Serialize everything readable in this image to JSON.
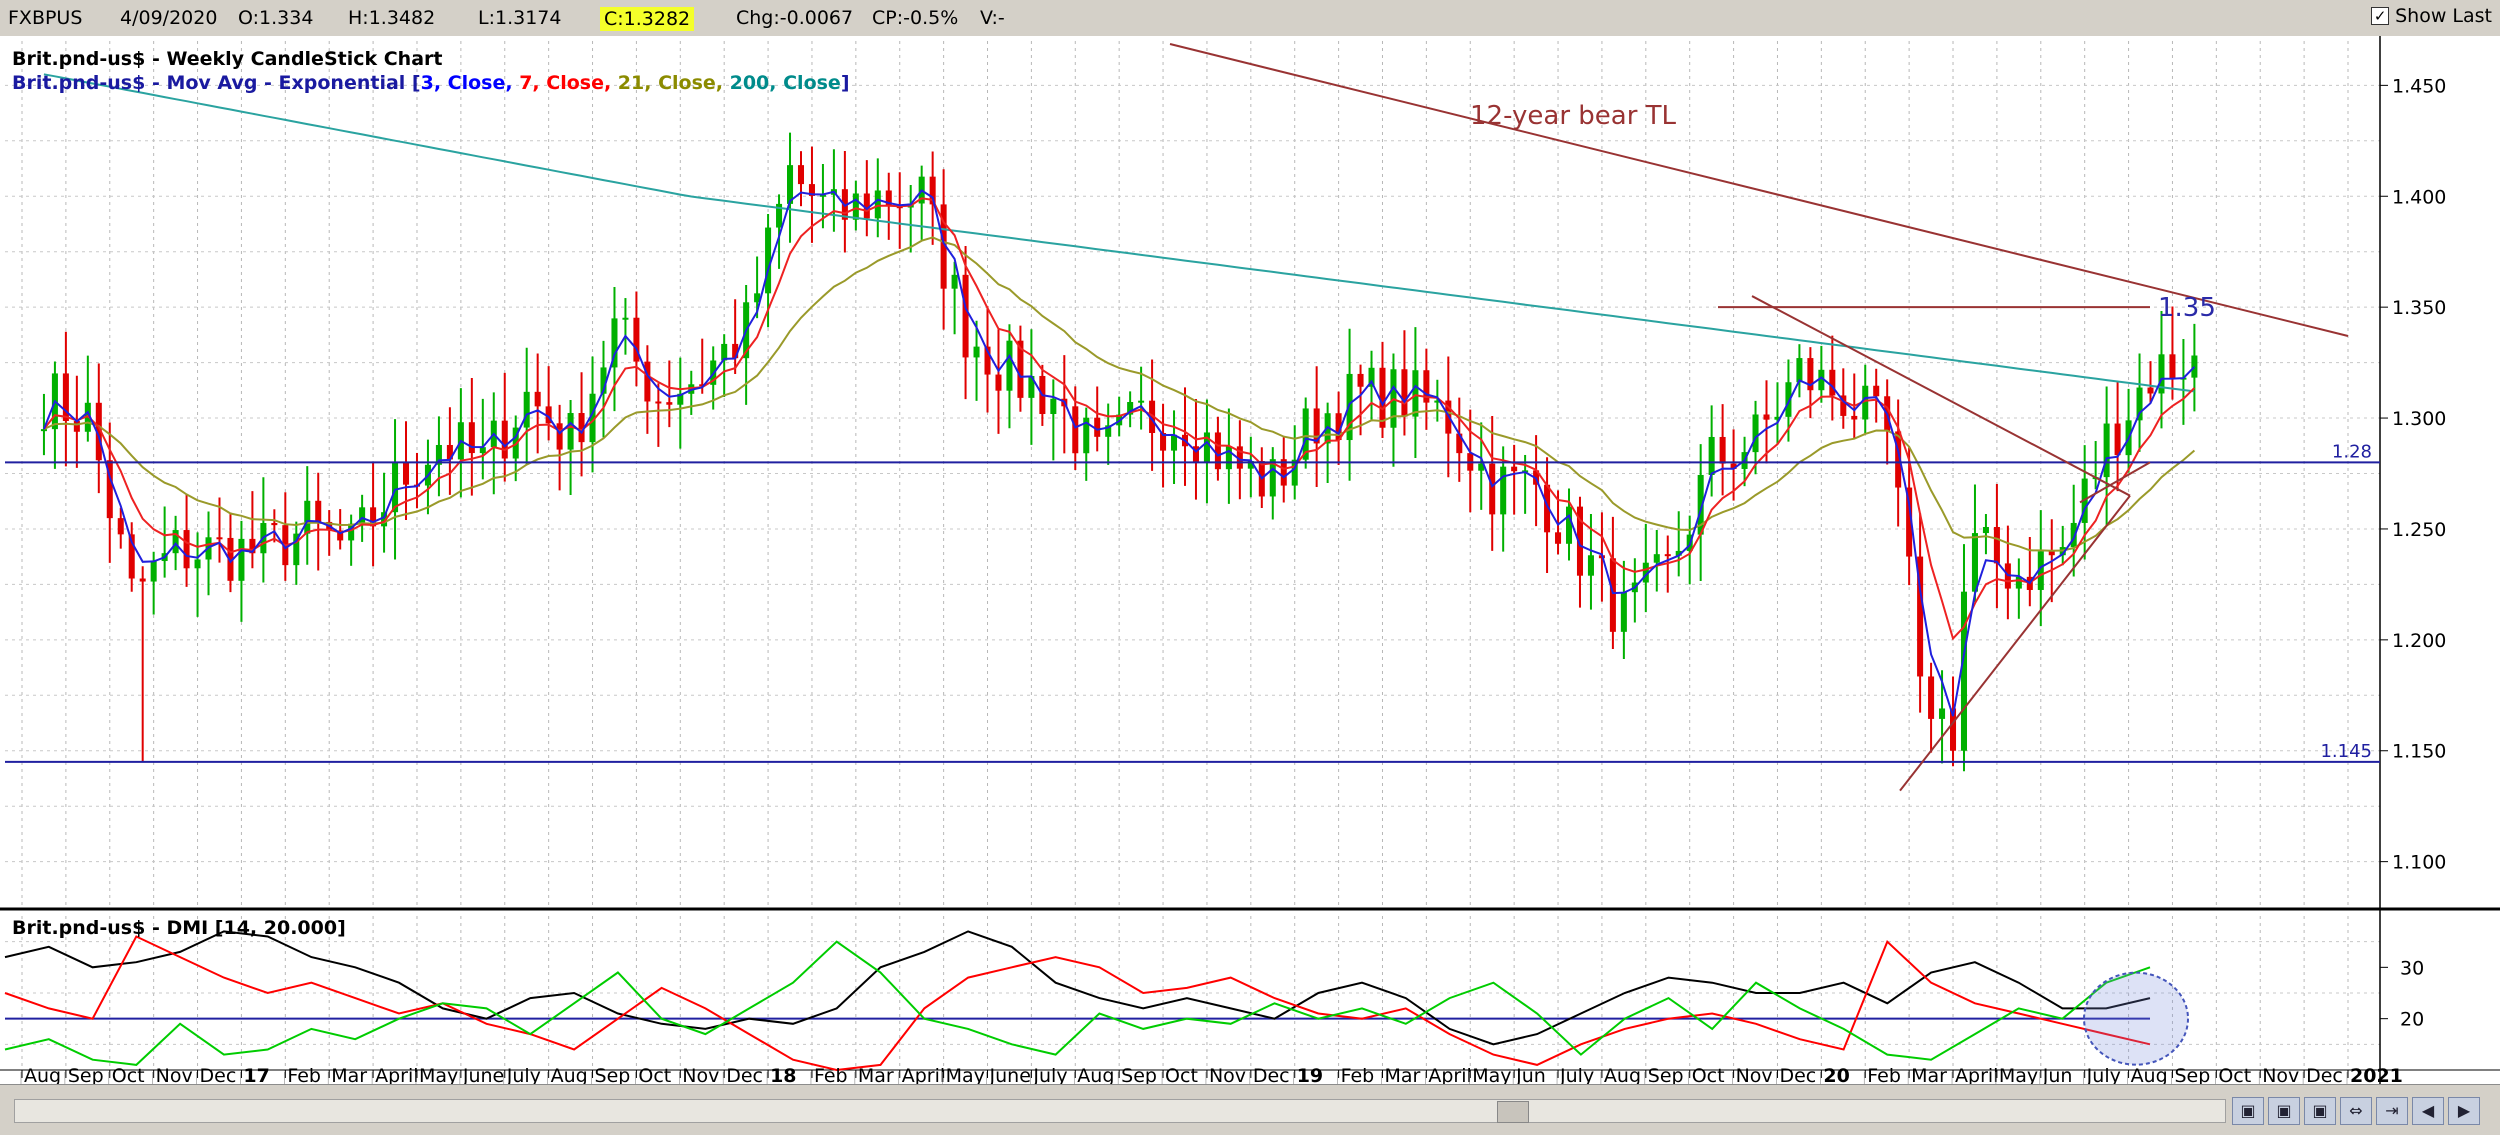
{
  "header": {
    "symbol": "FXBPUS",
    "date": "4/09/2020",
    "open": "O:1.334",
    "high": "H:1.3482",
    "low": "L:1.3174",
    "close": "C:1.3282",
    "change": "Chg:-0.0067",
    "change_pct": "CP:-0.5%",
    "volume": "V:-",
    "show_last_label": "Show Last",
    "show_last_checked": "✓"
  },
  "chart_data": [
    {
      "type": "candlestick",
      "title": "Brit.pnd-us$ - Weekly CandleStick Chart",
      "indicator_label": "Brit.pnd-us$ - Mov Avg - Exponential",
      "indicator_params": [
        {
          "text": "[",
          "color": "#1a1aa0"
        },
        {
          "text": "3, Close,",
          "color": "#0000ff"
        },
        {
          "text": " 7, Close,",
          "color": "#ff0000"
        },
        {
          "text": " 21, Close,",
          "color": "#8b8b00"
        },
        {
          "text": " 200, Close",
          "color": "#008b8b"
        },
        {
          "text": "]",
          "color": "#1a1aa0"
        }
      ],
      "ylim": [
        1.08,
        1.47
      ],
      "y_ticks": [
        "1.450",
        "1.400",
        "1.350",
        "1.300",
        "1.250",
        "1.200",
        "1.150",
        "1.100"
      ],
      "x_ticks": [
        "Aug",
        "Sep",
        "Oct",
        "Nov",
        "Dec",
        "17",
        "Feb",
        "Mar",
        "April",
        "May",
        "June",
        "July",
        "Aug",
        "Sep",
        "Oct",
        "Nov",
        "Dec",
        "18",
        "Feb",
        "Mar",
        "April",
        "May",
        "June",
        "July",
        "Aug",
        "Sep",
        "Oct",
        "Nov",
        "Dec",
        "19",
        "Feb",
        "Mar",
        "April",
        "May",
        "Jun",
        "July",
        "Aug",
        "Sep",
        "Oct",
        "Nov",
        "Dec",
        "20",
        "Feb",
        "Mar",
        "April",
        "May",
        "Jun",
        "July",
        "Aug",
        "Sep",
        "Oct",
        "Nov",
        "Dec",
        "2021"
      ],
      "bold_ticks": [
        "17",
        "18",
        "19",
        "20",
        "2021"
      ],
      "horizontal_levels": [
        {
          "value": 1.28,
          "label": "1.28",
          "color": "#2020a0"
        },
        {
          "value": 1.145,
          "label": "1.145",
          "color": "#2020a0"
        }
      ],
      "annotations": {
        "bear_trendline_label": "12-year bear TL",
        "resistance_label": "1.35"
      },
      "closes_key": [
        {
          "date": "2016-08",
          "close": 1.31
        },
        {
          "date": "2016-09",
          "close": 1.3
        },
        {
          "date": "2016-10",
          "close": 1.22
        },
        {
          "date": "2016-11",
          "close": 1.24
        },
        {
          "date": "2016-12",
          "close": 1.24
        },
        {
          "date": "2017-01",
          "close": 1.24
        },
        {
          "date": "2017-02",
          "close": 1.25
        },
        {
          "date": "2017-03",
          "close": 1.24
        },
        {
          "date": "2017-04",
          "close": 1.27
        },
        {
          "date": "2017-05",
          "close": 1.29
        },
        {
          "date": "2017-06",
          "close": 1.28
        },
        {
          "date": "2017-07",
          "close": 1.31
        },
        {
          "date": "2017-08",
          "close": 1.29
        },
        {
          "date": "2017-09",
          "close": 1.34
        },
        {
          "date": "2017-10",
          "close": 1.31
        },
        {
          "date": "2017-11",
          "close": 1.32
        },
        {
          "date": "2017-12",
          "close": 1.34
        },
        {
          "date": "2018-01",
          "close": 1.41
        },
        {
          "date": "2018-02",
          "close": 1.39
        },
        {
          "date": "2018-03",
          "close": 1.4
        },
        {
          "date": "2018-04",
          "close": 1.4
        },
        {
          "date": "2018-05",
          "close": 1.34
        },
        {
          "date": "2018-06",
          "close": 1.32
        },
        {
          "date": "2018-07",
          "close": 1.31
        },
        {
          "date": "2018-08",
          "close": 1.28
        },
        {
          "date": "2018-09",
          "close": 1.3
        },
        {
          "date": "2018-10",
          "close": 1.3
        },
        {
          "date": "2018-11",
          "close": 1.28
        },
        {
          "date": "2018-12",
          "close": 1.27
        },
        {
          "date": "2019-01",
          "close": 1.3
        },
        {
          "date": "2019-02",
          "close": 1.31
        },
        {
          "date": "2019-03",
          "close": 1.31
        },
        {
          "date": "2019-04",
          "close": 1.3
        },
        {
          "date": "2019-05",
          "close": 1.27
        },
        {
          "date": "2019-06",
          "close": 1.27
        },
        {
          "date": "2019-07",
          "close": 1.24
        },
        {
          "date": "2019-08",
          "close": 1.21
        },
        {
          "date": "2019-09",
          "close": 1.23
        },
        {
          "date": "2019-10",
          "close": 1.28
        },
        {
          "date": "2019-11",
          "close": 1.29
        },
        {
          "date": "2019-12",
          "close": 1.32
        },
        {
          "date": "2020-01",
          "close": 1.31
        },
        {
          "date": "2020-02",
          "close": 1.29
        },
        {
          "date": "2020-03",
          "close": 1.16
        },
        {
          "date": "2020-04",
          "close": 1.24
        },
        {
          "date": "2020-05",
          "close": 1.23
        },
        {
          "date": "2020-06",
          "close": 1.24
        },
        {
          "date": "2020-07",
          "close": 1.29
        },
        {
          "date": "2020-08",
          "close": 1.32
        },
        {
          "date": "2020-09",
          "close": 1.3282
        }
      ]
    },
    {
      "type": "line",
      "title": "Brit.pnd-us$ - DMI [14, 20.000]",
      "y_ticks": [
        "30",
        "20"
      ],
      "threshold": 20,
      "ylim": [
        10,
        40
      ],
      "series": [
        {
          "color": "#000000",
          "values": [
            32,
            34,
            30,
            31,
            33,
            37,
            36,
            32,
            30,
            27,
            22,
            20,
            24,
            25,
            21,
            19,
            18,
            20,
            19,
            22,
            30,
            33,
            37,
            34,
            27,
            24,
            22,
            24,
            22,
            20,
            25,
            27,
            24,
            18,
            15,
            17,
            21,
            25,
            28,
            27,
            25,
            25,
            27,
            23,
            29,
            31,
            27,
            22,
            22,
            24
          ]
        },
        {
          "color": "#ff0000",
          "values": [
            25,
            22,
            20,
            36,
            32,
            28,
            25,
            27,
            24,
            21,
            23,
            19,
            17,
            14,
            20,
            26,
            22,
            17,
            12,
            9,
            11,
            22,
            28,
            30,
            32,
            30,
            25,
            26,
            28,
            24,
            21,
            20,
            22,
            17,
            13,
            11,
            15,
            18,
            20,
            21,
            19,
            16,
            14,
            35,
            27,
            23,
            21,
            19,
            17,
            15
          ]
        },
        {
          "color": "#00cc00",
          "values": [
            14,
            16,
            12,
            11,
            19,
            13,
            14,
            18,
            16,
            20,
            23,
            22,
            17,
            23,
            29,
            20,
            17,
            22,
            27,
            35,
            29,
            20,
            18,
            15,
            13,
            21,
            18,
            20,
            19,
            23,
            20,
            22,
            19,
            24,
            27,
            21,
            13,
            20,
            24,
            18,
            27,
            22,
            18,
            13,
            12,
            17,
            22,
            20,
            27,
            30
          ]
        }
      ]
    }
  ]
}
